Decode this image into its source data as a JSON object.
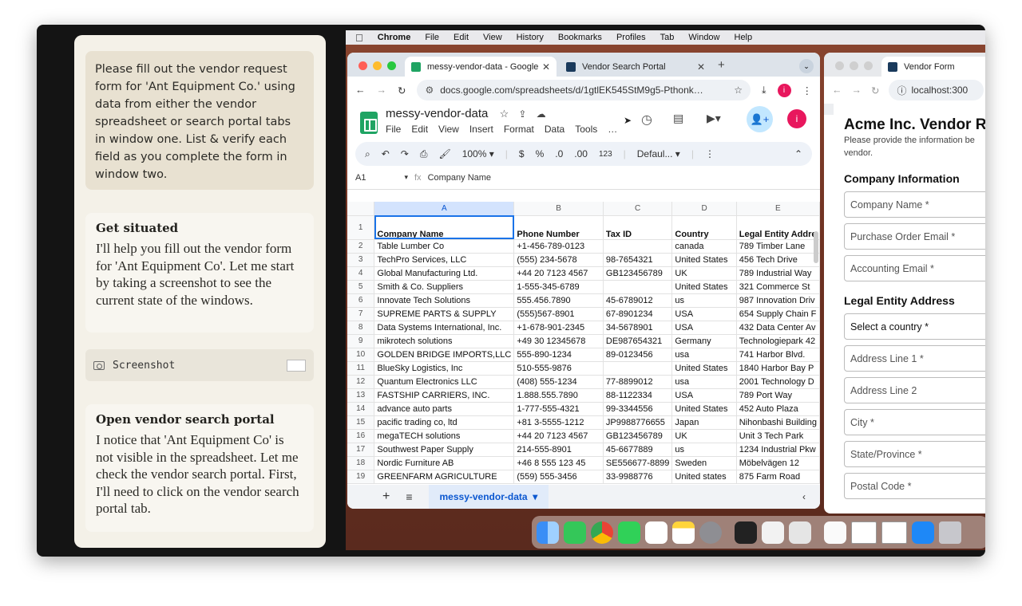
{
  "chat": {
    "user_message": "Please fill out the vendor request form for 'Ant Equipment Co.' using data from either the vendor spreadsheet or search portal tabs in window one. List & verify each field as you complete the form in window two.",
    "step1_title": "Get situated",
    "step1_body": "I'll help you fill out the vendor form for 'Ant Equipment Co'. Let me start by taking a screenshot to see the current state of the windows.",
    "tool_label": "Screenshot",
    "step2_title": "Open vendor search portal",
    "step2_body": "I notice that 'Ant Equipment Co' is not visible in the spreadsheet. Let me check the vendor search portal. First, I'll need to click on the vendor search portal tab."
  },
  "menubar": [
    "Chrome",
    "File",
    "Edit",
    "View",
    "History",
    "Bookmarks",
    "Profiles",
    "Tab",
    "Window",
    "Help"
  ],
  "win1": {
    "tab1": "messy-vendor-data - Google",
    "tab2": "Vendor Search Portal",
    "url": "docs.google.com/spreadsheets/d/1gtlEK545StM9g5-Pthonk…",
    "avatar": "i",
    "doc_title": "messy-vendor-data",
    "menus": [
      "File",
      "Edit",
      "View",
      "Insert",
      "Format",
      "Data",
      "Tools",
      "…"
    ],
    "zoom": "100%",
    "font": "Defaul...",
    "cell_ref": "A1",
    "formula": "Company Name",
    "sheet_tab": "messy-vendor-data",
    "col_letters": [
      "",
      "A",
      "B",
      "C",
      "D",
      "E"
    ],
    "rows": [
      [
        "1",
        "Company Name",
        "Phone Number",
        "Tax ID",
        "Country",
        "Legal Entity Addre"
      ],
      [
        "2",
        "Table Lumber Co",
        "+1-456-789-0123",
        "",
        "canada",
        "789 Timber Lane"
      ],
      [
        "3",
        "TechPro Services, LLC",
        "(555) 234-5678",
        "98-7654321",
        "United States",
        "456 Tech Drive"
      ],
      [
        "4",
        "Global Manufacturing Ltd.",
        "+44 20 7123 4567",
        "GB123456789",
        "UK",
        "789 Industrial Way"
      ],
      [
        "5",
        "Smith & Co. Suppliers",
        "1-555-345-6789",
        "",
        "United States",
        "321 Commerce St"
      ],
      [
        "6",
        "Innovate Tech Solutions",
        "555.456.7890",
        "45-6789012",
        "us",
        "987 Innovation Driv"
      ],
      [
        "7",
        "SUPREME PARTS & SUPPLY",
        "(555)567-8901",
        "67-8901234",
        "USA",
        "654 Supply Chain F"
      ],
      [
        "8",
        "Data Systems International, Inc.",
        "+1-678-901-2345",
        "34-5678901",
        "USA",
        "432 Data Center Av"
      ],
      [
        "9",
        "mikrotech solutions",
        "+49 30 12345678",
        "DE987654321",
        "Germany",
        "Technologiepark 42"
      ],
      [
        "10",
        "GOLDEN BRIDGE IMPORTS,LLC",
        "555-890-1234",
        "89-0123456",
        "usa",
        "741 Harbor Blvd."
      ],
      [
        "11",
        "BlueSky Logistics, Inc",
        "510-555-9876",
        "",
        "United States",
        "1840 Harbor Bay P"
      ],
      [
        "12",
        "Quantum Electronics LLC",
        "(408) 555-1234",
        "77-8899012",
        "usa",
        "2001 Technology D"
      ],
      [
        "13",
        "FASTSHIP CARRIERS, INC.",
        "1.888.555.7890",
        "88-1122334",
        "USA",
        "789 Port Way"
      ],
      [
        "14",
        "advance auto parts",
        "1-777-555-4321",
        "99-3344556",
        "United States",
        "452 Auto Plaza"
      ],
      [
        "15",
        "pacific trading co, ltd",
        "+81 3-5555-1212",
        "JP9988776655",
        "Japan",
        "Nihonbashi Building"
      ],
      [
        "16",
        "megaTECH solutions",
        "+44 20 7123 4567",
        "GB123456789",
        "UK",
        "Unit 3 Tech Park"
      ],
      [
        "17",
        "Southwest Paper Supply",
        "214-555-8901",
        "45-6677889",
        "us",
        "1234 Industrial Pkw"
      ],
      [
        "18",
        "Nordic Furniture AB",
        "+46 8 555 123 45",
        "SE556677-8899",
        "Sweden",
        "Möbelvägen 12"
      ],
      [
        "19",
        "GREENFARM AGRICULTURE",
        "(559) 555-3456",
        "33-9988776",
        "United states",
        "875 Farm Road"
      ]
    ]
  },
  "win2": {
    "tab": "Vendor Form",
    "url": "localhost:300",
    "title": "Acme Inc. Vendor R",
    "subtitle1": "Please provide the information be",
    "subtitle2": "vendor.",
    "sec1": "Company Information",
    "f1": "Company Name *",
    "f2": "Purchase Order Email *",
    "f3": "Accounting Email *",
    "sec2": "Legal Entity Address",
    "f4": "Select a country *",
    "f5": "Address Line 1 *",
    "f6": "Address Line 2",
    "f7": "City *",
    "f8": "State/Province *",
    "f9": "Postal Code *"
  },
  "colors": {
    "sheets_green": "#1fa463",
    "avatar": "#e8175d",
    "select_blue": "#1a73e8"
  }
}
